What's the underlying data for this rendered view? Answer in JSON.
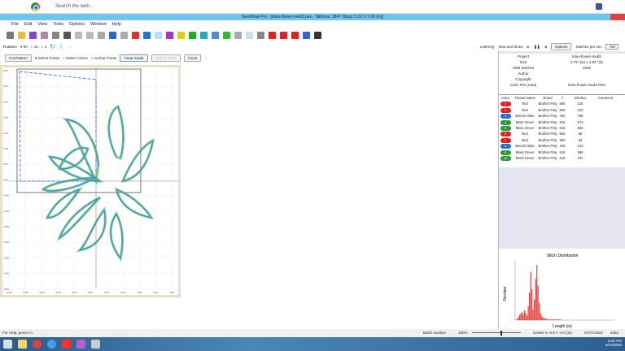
{
  "browser": {
    "search_placeholder": "Search the web..."
  },
  "window": {
    "title": "SewWhat-Pro - [lotus-flower-med2.pes - Stitches: 3847  Hoop: 5.12 X 7.09 (in)]"
  },
  "menu": [
    "File",
    "Edit",
    "View",
    "Tools",
    "Options",
    "Window",
    "Help"
  ],
  "rotation": {
    "label": "Rotation",
    "options": [
      "90",
      "10",
      "1"
    ],
    "selected": "90"
  },
  "right_toolbar": {
    "lettering": "Lettering",
    "sew_and_show": "Sew and Show",
    "options": "Options",
    "stitches_per_sec_label": "Stitches per sec",
    "stitches_per_sec": "750"
  },
  "edit_bar": {
    "cut_pattern": "Cut Pattern",
    "select_points": "Select Points",
    "select_colors": "Select Colors",
    "anchor_points": "Anchor Points",
    "hoop_guide": "Hoop Guide",
    "split_at_stitch": "Split at Stitch",
    "close": "Close",
    "selected_mode": "Select Points"
  },
  "canvas": {
    "x_ticks": [
      "-2.50",
      "-2.00",
      "-1.50",
      "-1.00",
      "-0.50",
      "0.00",
      "0.50",
      "1.00",
      "1.50",
      "2.00",
      "2.50"
    ],
    "y_ticks": [
      "3.50",
      "3.00",
      "2.50",
      "2.00",
      "1.50",
      "1.00",
      "0.50",
      "0.00",
      "-0.50",
      "-1.00",
      "-1.50",
      "-2.00",
      "-2.50",
      "-3.00",
      "-3.50"
    ]
  },
  "info": [
    {
      "k": "Project",
      "v": "lotus-flower-med2"
    },
    {
      "k": "Size",
      "v": "3.75 \"(w) x 4.84 \"(h)"
    },
    {
      "k": "Total Stitches",
      "v": "4052"
    },
    {
      "k": "Author",
      "v": ""
    },
    {
      "k": "Copyright",
      "v": ""
    },
    {
      "k": "Color File (read)",
      "v": "lotus-flower-med2.PES"
    }
  ],
  "color_table": {
    "headers": [
      "Color",
      "Thread Name",
      "Brand",
      "#",
      "Stitches",
      "Comment"
    ],
    "rows": [
      {
        "n": "1",
        "color": "#e02020",
        "name": "Red",
        "brand": "Brother Poly",
        "num": "800",
        "stitches": "215"
      },
      {
        "n": "2",
        "color": "#e02020",
        "name": "Red",
        "brand": "Brother Poly",
        "num": "800",
        "stitches": "223"
      },
      {
        "n": "3",
        "color": "#1f6fd6",
        "name": "Electric Blue",
        "brand": "Brother Poly",
        "num": "420",
        "stitches": "758"
      },
      {
        "n": "4",
        "color": "#2e9a35",
        "name": "Moss Green",
        "brand": "Brother Poly",
        "num": "515",
        "stitches": "873"
      },
      {
        "n": "5",
        "color": "#2e9a35",
        "name": "Moss Green",
        "brand": "Brother Poly",
        "num": "515",
        "stitches": "883"
      },
      {
        "n": "6",
        "color": "#e02020",
        "name": "Red",
        "brand": "Brother Poly",
        "num": "800",
        "stitches": "65"
      },
      {
        "n": "7",
        "color": "#e02020",
        "name": "Red",
        "brand": "Brother Poly",
        "num": "800",
        "stitches": "84"
      },
      {
        "n": "8",
        "color": "#1f6fd6",
        "name": "Electric Blue",
        "brand": "Brother Poly",
        "num": "420",
        "stitches": "213"
      },
      {
        "n": "9",
        "color": "#2e9a35",
        "name": "Moss Green",
        "brand": "Brother Poly",
        "num": "515",
        "stitches": "386"
      },
      {
        "n": "10",
        "color": "#2e9a35",
        "name": "Moss Green",
        "brand": "Brother Poly",
        "num": "515",
        "stitches": "237"
      }
    ]
  },
  "stitch_chart": {
    "title": "Stitch Distribution",
    "xlabel": "Length (in)",
    "ylabel": "Number"
  },
  "status": {
    "help": "For Help, press F1",
    "batch": "Batch inactive",
    "zoom": "100%",
    "center": "Center X -0.0  Y -0.0 (in)",
    "stitches_label": "STITCHES:",
    "stitches": "4052"
  },
  "taskbar": {
    "time": "5:31 PM",
    "date": "8/12/2020"
  }
}
